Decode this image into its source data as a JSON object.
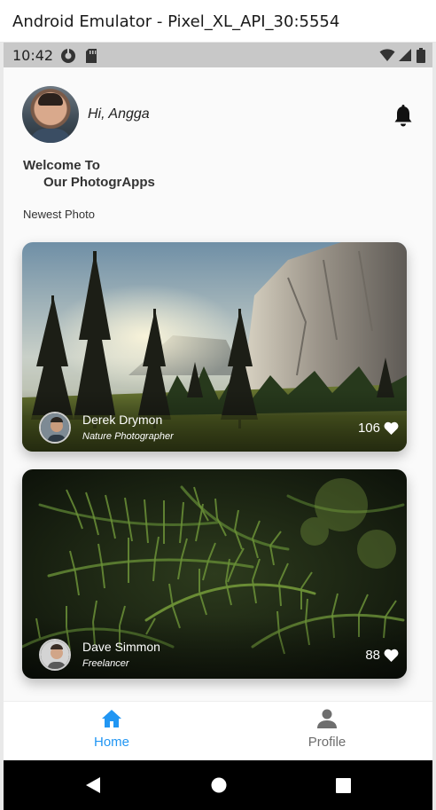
{
  "window": {
    "title": "Android Emulator - Pixel_XL_API_30:5554"
  },
  "status_bar": {
    "time": "10:42"
  },
  "header": {
    "greeting": "Hi, Angga"
  },
  "welcome": {
    "line1": "Welcome To",
    "line2": "Our PhotogrApps"
  },
  "section_title": "Newest Photo",
  "photos": [
    {
      "photographer": "Derek Drymon",
      "role": "Nature Photographer",
      "likes": "106"
    },
    {
      "photographer": "Dave Simmon",
      "role": "Freelancer",
      "likes": "88"
    }
  ],
  "bottom_nav": {
    "items": [
      {
        "label": "Home",
        "icon": "home-icon",
        "active": true
      },
      {
        "label": "Profile",
        "icon": "person-icon",
        "active": false
      }
    ]
  },
  "colors": {
    "accent": "#2196f3",
    "inactive": "#6e6e6e",
    "background": "#fafafa"
  }
}
